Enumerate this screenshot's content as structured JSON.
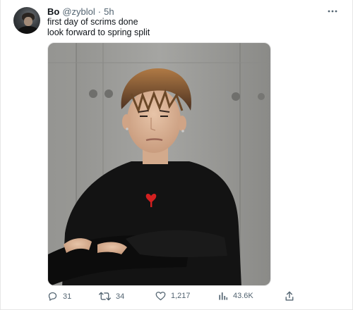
{
  "tweet": {
    "author_name": "Bo",
    "author_handle": "@zyblol",
    "separator": "·",
    "time": "5h",
    "text_lines": [
      "first day of scrims done",
      "look forward to spring split"
    ]
  },
  "actions": {
    "reply_count": "31",
    "retweet_count": "34",
    "like_count": "1,217",
    "view_count": "43.6K"
  },
  "icons": {
    "more": "more-horizontal-icon",
    "reply": "reply-icon",
    "retweet": "retweet-icon",
    "like": "heart-icon",
    "views": "bar-chart-icon",
    "share": "share-icon"
  },
  "colors": {
    "text_primary": "#0f1419",
    "text_secondary": "#536471",
    "border": "#e6e6e6",
    "heart_logo": "#d32020"
  }
}
